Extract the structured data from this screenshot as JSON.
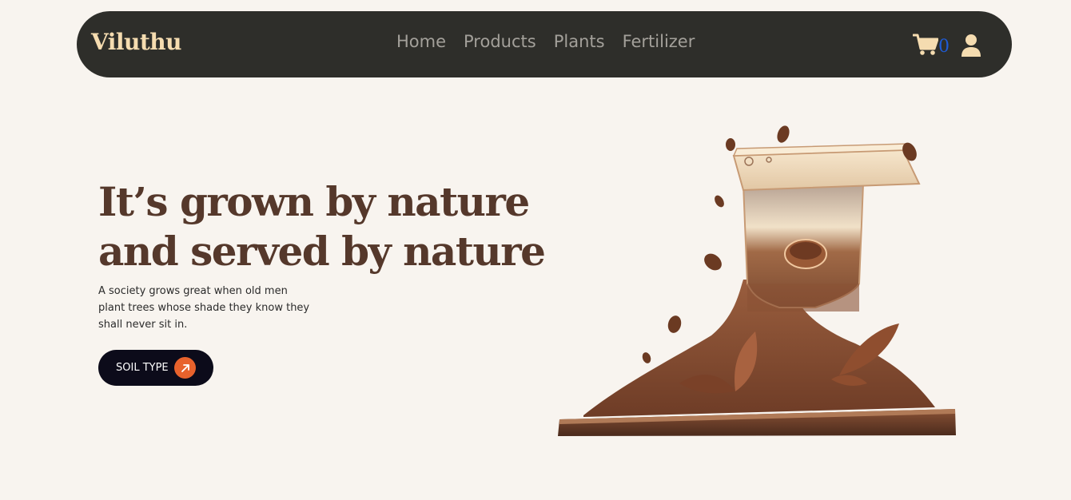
{
  "nav": {
    "brand": "Viluthu",
    "links": [
      "Home",
      "Products",
      "Plants",
      "Fertilizer"
    ],
    "cart_count": "0",
    "icons": {
      "cart": "cart-icon",
      "user": "user-icon"
    }
  },
  "hero": {
    "title_line1": "It’s grown by nature",
    "title_line2": "and served by nature",
    "description": "A society grows great when old men plant trees whose shade they know they shall never sit in.",
    "cta_label": "SOIL TYPE",
    "cta_icon": "arrow-up-right-icon",
    "illustration": "coffee-grinder-illustration"
  },
  "colors": {
    "background": "#f8f4ef",
    "navbar": "#2e2e2a",
    "brand": "#f5dcb0",
    "nav_link": "#a3a09a",
    "title": "#55382b",
    "cta_bg": "#0c0b1a",
    "cta_accent": "#e8622c",
    "cart_count": "#1e5bd6"
  }
}
